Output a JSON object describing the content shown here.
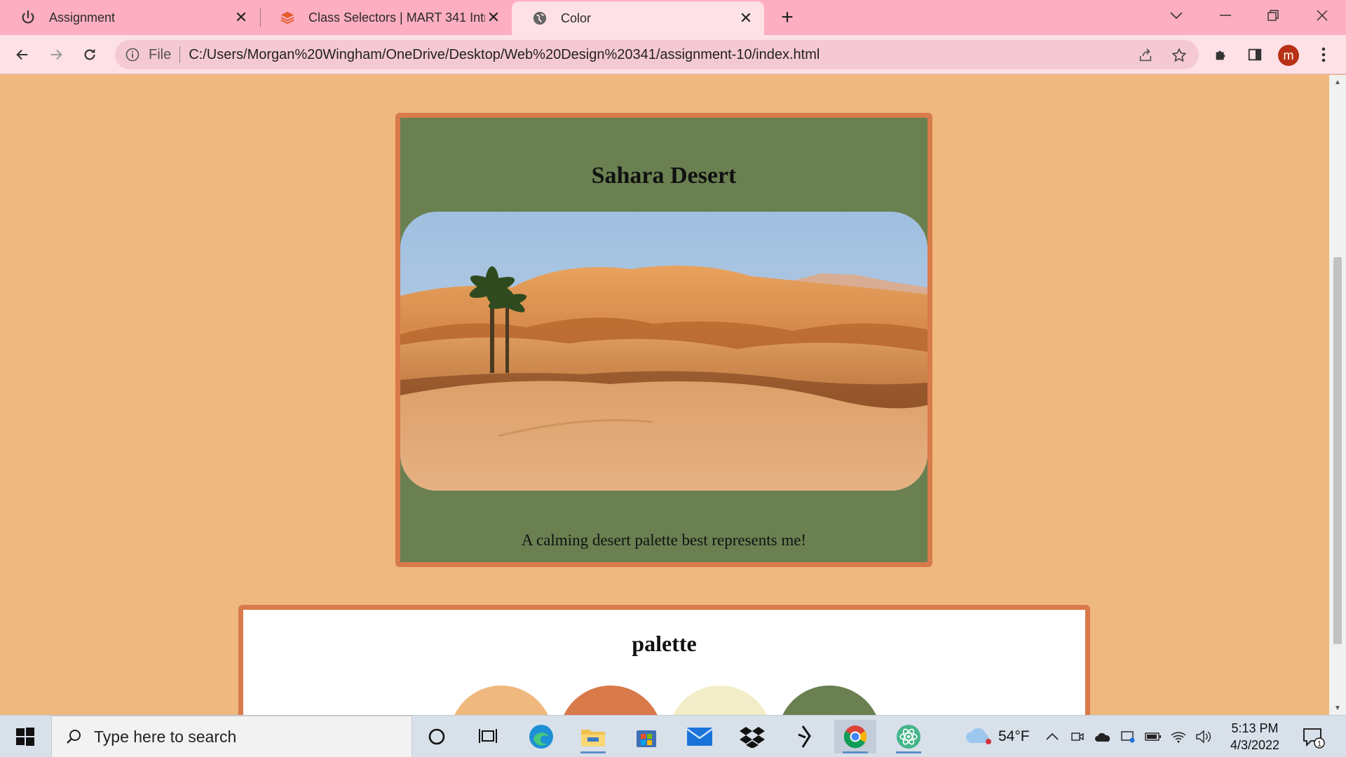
{
  "browser": {
    "tabs": [
      {
        "title": "Assignment",
        "icon": "power-icon"
      },
      {
        "title": "Class Selectors | MART 341 Intro",
        "icon": "layers-icon"
      },
      {
        "title": "Color",
        "icon": "globe-icon",
        "active": true
      }
    ],
    "new_tab": "+",
    "file_label": "File",
    "url": "C:/Users/Morgan%20Wingham/OneDrive/Desktop/Web%20Design%20341/assignment-10/index.html",
    "profile_initial": "m"
  },
  "page": {
    "background": "#efb87e",
    "card": {
      "title": "Sahara Desert",
      "image_label": "desert-photo",
      "caption": "A calming desert palette best represents me!",
      "background": "#6a8051",
      "border": "#d97a4a"
    },
    "palette": {
      "title": "palette",
      "swatches": [
        "#efb87e",
        "#d97a4a",
        "#f2ecc8",
        "#6a8051"
      ]
    }
  },
  "taskbar": {
    "search_placeholder": "Type here to search",
    "weather_temp": "54°F",
    "time": "5:13 PM",
    "date": "4/3/2022",
    "notification_count": "1"
  }
}
